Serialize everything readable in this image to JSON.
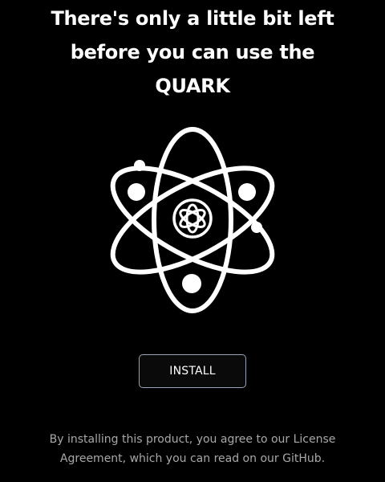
{
  "header": {
    "title_lines": [
      "There's only a little bit left",
      "before you can use the",
      "QUARK"
    ]
  },
  "logo": {
    "icon": "atom-icon",
    "color": "#ffffff"
  },
  "actions": {
    "install_label": "INSTALL"
  },
  "footer": {
    "notice_lines": [
      "By installing this product, you agree to our License",
      "Agreement, which you can read on our GitHub."
    ]
  },
  "colors": {
    "background": "#000000",
    "text": "#ffffff",
    "muted_text": "#a8a8a8",
    "button_border": "#9aa2b8"
  }
}
